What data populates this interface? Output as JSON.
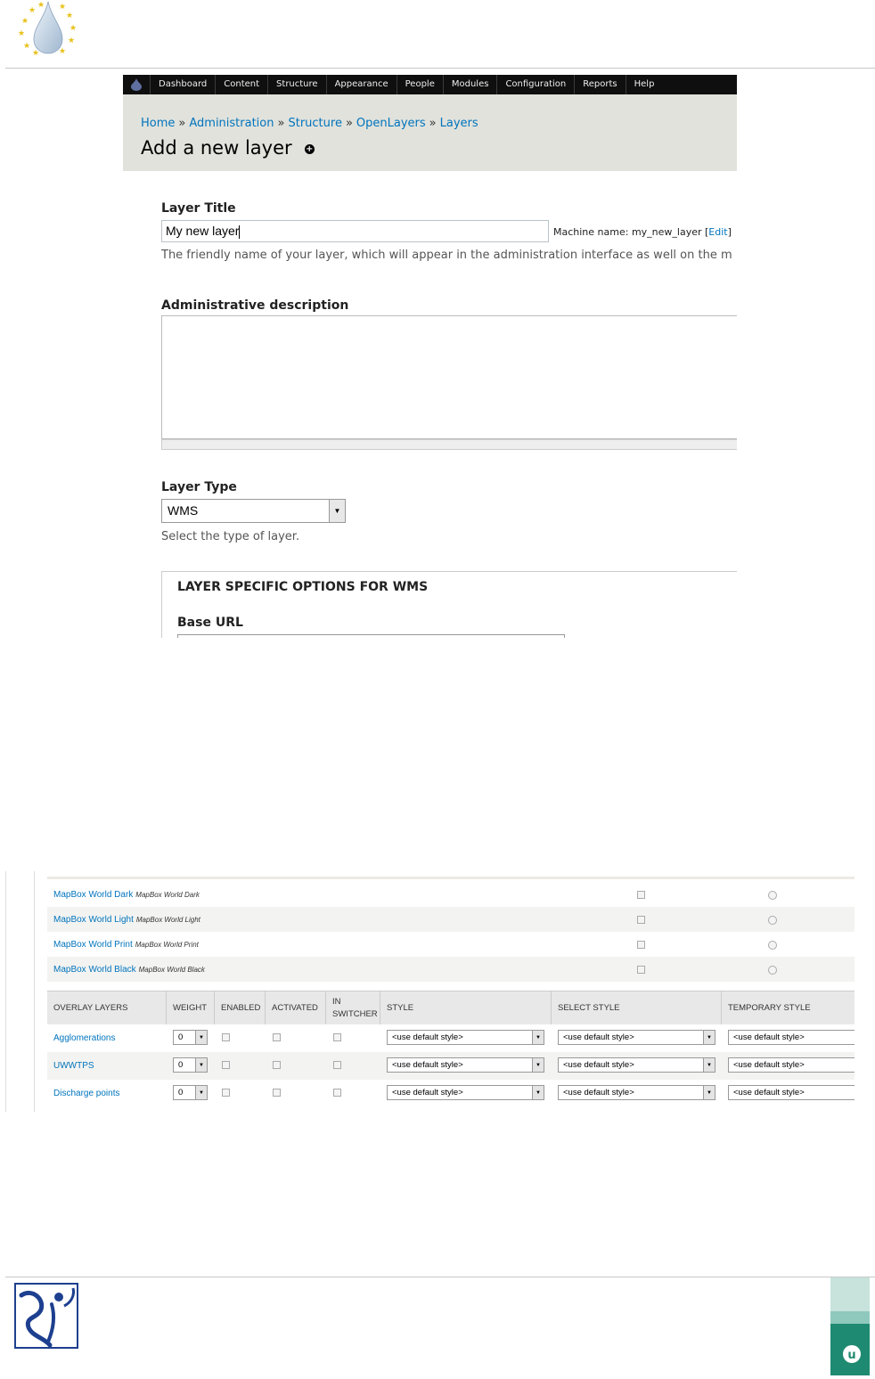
{
  "toolbar": {
    "items": [
      "Dashboard",
      "Content",
      "Structure",
      "Appearance",
      "People",
      "Modules",
      "Configuration",
      "Reports",
      "Help"
    ]
  },
  "breadcrumb": [
    "Home",
    "Administration",
    "Structure",
    "OpenLayers",
    "Layers"
  ],
  "breadcrumb_sep": "»",
  "page_title": "Add a new layer",
  "form": {
    "layer_title_label": "Layer Title",
    "layer_title_value": "My new layer",
    "machine_name_prefix": "Machine name: my_new_layer [",
    "machine_name_edit": "Edit",
    "machine_name_suffix": "]",
    "layer_title_desc": "The friendly name of your layer, which will appear in the administration interface as well on the m",
    "admin_desc_label": "Administrative description",
    "layer_type_label": "Layer Type",
    "layer_type_value": "WMS",
    "layer_type_desc": "Select the type of layer.",
    "fieldset_legend": "LAYER SPECIFIC OPTIONS FOR WMS",
    "base_url_label": "Base URL"
  },
  "base_layers": [
    {
      "name": "MapBox World Dark",
      "sub": "MapBox World Dark"
    },
    {
      "name": "MapBox World Light",
      "sub": "MapBox World Light"
    },
    {
      "name": "MapBox World Print",
      "sub": "MapBox World Print"
    },
    {
      "name": "MapBox World Black",
      "sub": "MapBox World Black"
    }
  ],
  "overlay_headers": [
    "OVERLAY LAYERS",
    "WEIGHT",
    "ENABLED",
    "ACTIVATED",
    "IN",
    "SWITCHER",
    "STYLE",
    "SELECT STYLE",
    "TEMPORARY STYLE"
  ],
  "overlay_layers": [
    {
      "name": "Agglomerations",
      "weight": "0",
      "style": "<use default style>",
      "select_style": "<use default style>",
      "temp_style": "<use default style>"
    },
    {
      "name": "UWWTPS",
      "weight": "0",
      "style": "<use default style>",
      "select_style": "<use default style>",
      "temp_style": "<use default style>"
    },
    {
      "name": "Discharge points",
      "weight": "0",
      "style": "<use default style>",
      "select_style": "<use default style>",
      "temp_style": "<use default style>"
    }
  ],
  "colors": {
    "toolbar": "#0f0f0f",
    "admin_header": "#e1e2dc",
    "link": "#0074bd"
  }
}
